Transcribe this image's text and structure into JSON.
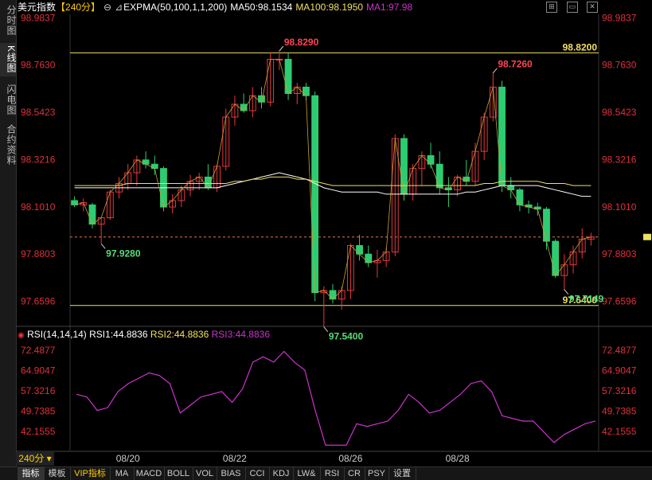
{
  "sidebar": {
    "tabs": [
      {
        "label": "分时图",
        "active": false
      },
      {
        "label": "K线图",
        "active": true
      },
      {
        "label": "闪电图",
        "active": false
      },
      {
        "label": "合约资料",
        "active": false
      }
    ]
  },
  "header": {
    "title": "美元指数",
    "period": "【240分】",
    "indicator": "EXPMA(50,100,1,1,200)",
    "ma50": "MA50:98.1534",
    "ma100": "MA100:98.1950",
    "ma1": "MA1:97.98"
  },
  "rsi_header": {
    "label": "RSI(14,14,14)",
    "rsi1": "RSI1:44.8836",
    "rsi2": "RSI2:44.8836",
    "rsi3": "RSI3:44.8836"
  },
  "colors": {
    "up": "#e8383d",
    "down": "#2ecc71",
    "ma50": "#ffffff",
    "ma100": "#f0e060",
    "ma1": "#cc33cc",
    "rsi": "#cc33cc",
    "hline": "#f0e060",
    "axis_label": "#e0303a"
  },
  "chart_data": [
    {
      "type": "candlestick",
      "title": "美元指数 240分",
      "y_ticks": [
        "98.9837",
        "98.7630",
        "98.5423",
        "98.3216",
        "98.1010",
        "97.8803",
        "97.6596"
      ],
      "ylim": [
        97.55,
        99.0
      ],
      "x_ticks": [
        {
          "label": "08/20",
          "index": 6
        },
        {
          "label": "08/22",
          "index": 18
        },
        {
          "label": "08/26",
          "index": 31
        },
        {
          "label": "08/28",
          "index": 43
        }
      ],
      "candles": [
        {
          "o": 98.13,
          "h": 98.15,
          "l": 98.1,
          "c": 98.11
        },
        {
          "o": 98.11,
          "h": 98.14,
          "l": 98.08,
          "c": 98.12
        },
        {
          "o": 98.11,
          "h": 98.12,
          "l": 98.0,
          "c": 98.02
        },
        {
          "o": 98.02,
          "h": 98.05,
          "l": 97.93,
          "c": 98.05
        },
        {
          "o": 98.05,
          "h": 98.18,
          "l": 98.04,
          "c": 98.17
        },
        {
          "o": 98.17,
          "h": 98.24,
          "l": 98.14,
          "c": 98.21
        },
        {
          "o": 98.21,
          "h": 98.3,
          "l": 98.18,
          "c": 98.26
        },
        {
          "o": 98.26,
          "h": 98.34,
          "l": 98.2,
          "c": 98.32
        },
        {
          "o": 98.32,
          "h": 98.36,
          "l": 98.28,
          "c": 98.3
        },
        {
          "o": 98.3,
          "h": 98.34,
          "l": 98.25,
          "c": 98.28
        },
        {
          "o": 98.28,
          "h": 98.29,
          "l": 98.08,
          "c": 98.1
        },
        {
          "o": 98.1,
          "h": 98.16,
          "l": 98.07,
          "c": 98.13
        },
        {
          "o": 98.13,
          "h": 98.2,
          "l": 98.1,
          "c": 98.18
        },
        {
          "o": 98.18,
          "h": 98.25,
          "l": 98.15,
          "c": 98.22
        },
        {
          "o": 98.22,
          "h": 98.26,
          "l": 98.18,
          "c": 98.24
        },
        {
          "o": 98.24,
          "h": 98.3,
          "l": 98.18,
          "c": 98.19
        },
        {
          "o": 98.19,
          "h": 98.3,
          "l": 98.17,
          "c": 98.29
        },
        {
          "o": 98.29,
          "h": 98.56,
          "l": 98.27,
          "c": 98.52
        },
        {
          "o": 98.52,
          "h": 98.62,
          "l": 98.48,
          "c": 98.58
        },
        {
          "o": 98.58,
          "h": 98.63,
          "l": 98.54,
          "c": 98.55
        },
        {
          "o": 98.55,
          "h": 98.66,
          "l": 98.52,
          "c": 98.62
        },
        {
          "o": 98.62,
          "h": 98.66,
          "l": 98.56,
          "c": 98.59
        },
        {
          "o": 98.59,
          "h": 98.82,
          "l": 98.57,
          "c": 98.79
        },
        {
          "o": 98.79,
          "h": 98.83,
          "l": 98.74,
          "c": 98.79
        },
        {
          "o": 98.79,
          "h": 98.82,
          "l": 98.6,
          "c": 98.63
        },
        {
          "o": 98.63,
          "h": 98.68,
          "l": 98.58,
          "c": 98.66
        },
        {
          "o": 98.66,
          "h": 98.68,
          "l": 98.6,
          "c": 98.62
        },
        {
          "o": 98.62,
          "h": 98.64,
          "l": 97.66,
          "c": 97.7
        },
        {
          "o": 97.7,
          "h": 97.73,
          "l": 97.54,
          "c": 97.71
        },
        {
          "o": 97.71,
          "h": 97.74,
          "l": 97.65,
          "c": 97.67
        },
        {
          "o": 97.67,
          "h": 97.73,
          "l": 97.62,
          "c": 97.71
        },
        {
          "o": 97.71,
          "h": 97.93,
          "l": 97.67,
          "c": 97.92
        },
        {
          "o": 97.92,
          "h": 97.97,
          "l": 97.85,
          "c": 97.88
        },
        {
          "o": 97.88,
          "h": 97.92,
          "l": 97.82,
          "c": 97.84
        },
        {
          "o": 97.84,
          "h": 97.9,
          "l": 97.77,
          "c": 97.85
        },
        {
          "o": 97.85,
          "h": 97.91,
          "l": 97.82,
          "c": 97.89
        },
        {
          "o": 97.89,
          "h": 98.44,
          "l": 97.87,
          "c": 98.42
        },
        {
          "o": 98.42,
          "h": 98.44,
          "l": 98.13,
          "c": 98.16
        },
        {
          "o": 98.16,
          "h": 98.3,
          "l": 98.13,
          "c": 98.28
        },
        {
          "o": 98.28,
          "h": 98.36,
          "l": 98.2,
          "c": 98.34
        },
        {
          "o": 98.34,
          "h": 98.4,
          "l": 98.28,
          "c": 98.3
        },
        {
          "o": 98.3,
          "h": 98.36,
          "l": 98.16,
          "c": 98.19
        },
        {
          "o": 98.19,
          "h": 98.24,
          "l": 98.1,
          "c": 98.18
        },
        {
          "o": 98.18,
          "h": 98.25,
          "l": 98.15,
          "c": 98.24
        },
        {
          "o": 98.24,
          "h": 98.32,
          "l": 98.2,
          "c": 98.22
        },
        {
          "o": 98.22,
          "h": 98.4,
          "l": 98.2,
          "c": 98.36
        },
        {
          "o": 98.36,
          "h": 98.54,
          "l": 98.32,
          "c": 98.52
        },
        {
          "o": 98.52,
          "h": 98.73,
          "l": 98.5,
          "c": 98.66
        },
        {
          "o": 98.66,
          "h": 98.69,
          "l": 98.17,
          "c": 98.2
        },
        {
          "o": 98.2,
          "h": 98.24,
          "l": 98.14,
          "c": 98.18
        },
        {
          "o": 98.18,
          "h": 98.19,
          "l": 98.08,
          "c": 98.11
        },
        {
          "o": 98.11,
          "h": 98.13,
          "l": 98.07,
          "c": 98.1
        },
        {
          "o": 98.1,
          "h": 98.12,
          "l": 98.06,
          "c": 98.09
        },
        {
          "o": 98.09,
          "h": 98.1,
          "l": 97.9,
          "c": 97.94
        },
        {
          "o": 97.94,
          "h": 97.95,
          "l": 97.77,
          "c": 97.78
        },
        {
          "o": 97.78,
          "h": 97.88,
          "l": 97.71,
          "c": 97.83
        },
        {
          "o": 97.83,
          "h": 97.92,
          "l": 97.79,
          "c": 97.89
        },
        {
          "o": 97.89,
          "h": 98.0,
          "l": 97.86,
          "c": 97.95
        },
        {
          "o": 97.95,
          "h": 97.98,
          "l": 97.92,
          "c": 97.96
        }
      ],
      "hlines": [
        {
          "value": 98.82,
          "label": "98.8200"
        },
        {
          "value": 97.64,
          "label": "97.6400"
        }
      ],
      "dashed_line": 97.96,
      "annotations": [
        {
          "label": "98.8290",
          "value": 98.829,
          "index": 23,
          "color": "#ff4455"
        },
        {
          "label": "98.7260",
          "value": 98.726,
          "index": 47,
          "color": "#ff4455"
        },
        {
          "label": "97.9280",
          "value": 97.928,
          "index": 3,
          "color": "#55dd77"
        },
        {
          "label": "97.5400",
          "value": 97.54,
          "index": 28,
          "color": "#55dd77"
        },
        {
          "label": "97.7149",
          "value": 97.7149,
          "index": 55,
          "color": "#55dd77"
        }
      ],
      "ma50": [
        98.19,
        98.19,
        98.19,
        98.19,
        98.19,
        98.19,
        98.19,
        98.19,
        98.19,
        98.19,
        98.19,
        98.19,
        98.19,
        98.19,
        98.19,
        98.19,
        98.19,
        98.2,
        98.21,
        98.22,
        98.23,
        98.24,
        98.25,
        98.26,
        98.25,
        98.24,
        98.23,
        98.21,
        98.19,
        98.18,
        98.17,
        98.17,
        98.17,
        98.17,
        98.17,
        98.16,
        98.16,
        98.16,
        98.16,
        98.16,
        98.16,
        98.16,
        98.16,
        98.16,
        98.17,
        98.17,
        98.18,
        98.19,
        98.2,
        98.2,
        98.2,
        98.2,
        98.2,
        98.19,
        98.18,
        98.17,
        98.16,
        98.15,
        98.15
      ],
      "ma100": [
        98.2,
        98.2,
        98.2,
        98.2,
        98.2,
        98.2,
        98.21,
        98.21,
        98.21,
        98.21,
        98.21,
        98.21,
        98.21,
        98.21,
        98.21,
        98.21,
        98.21,
        98.21,
        98.22,
        98.22,
        98.23,
        98.23,
        98.24,
        98.24,
        98.24,
        98.23,
        98.23,
        98.22,
        98.21,
        98.2,
        98.2,
        98.2,
        98.2,
        98.2,
        98.2,
        98.2,
        98.2,
        98.2,
        98.2,
        98.2,
        98.2,
        98.2,
        98.2,
        98.2,
        98.2,
        98.2,
        98.21,
        98.21,
        98.22,
        98.22,
        98.22,
        98.22,
        98.22,
        98.21,
        98.21,
        98.21,
        98.2,
        98.2,
        98.2
      ]
    },
    {
      "type": "line",
      "title": "RSI(14,14,14)",
      "y_ticks": [
        "72.4877",
        "64.9047",
        "57.3216",
        "49.7385",
        "42.1555"
      ],
      "ylim": [
        35,
        76
      ],
      "series": [
        {
          "name": "RSI1",
          "values": [
            56,
            55,
            50,
            51,
            57,
            60,
            62,
            64,
            63,
            60,
            49,
            52,
            55,
            56,
            57,
            53,
            58,
            68,
            70,
            68,
            72,
            68,
            65,
            50,
            37,
            37,
            37,
            45,
            44,
            45,
            46,
            50,
            56,
            53,
            49,
            50,
            53,
            56,
            60,
            61,
            57,
            48,
            47,
            46,
            46,
            42,
            38,
            41,
            43,
            45,
            46
          ]
        }
      ]
    }
  ],
  "bottombar": {
    "period": "240分",
    "tabs": [
      "指标",
      "模板",
      "VIP指标",
      "MA",
      "MACD",
      "BOLL",
      "VOL",
      "BIAS",
      "CCI",
      "KDJ",
      "LW&",
      "RSI",
      "CR",
      "PSY",
      "设置"
    ]
  }
}
